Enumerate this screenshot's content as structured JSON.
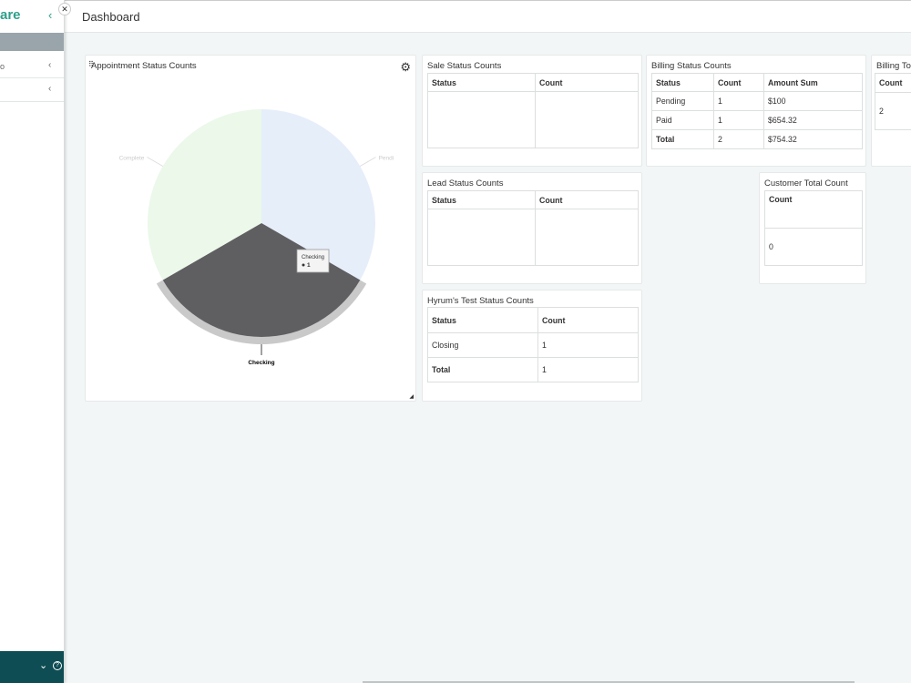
{
  "sidebar": {
    "brand": "are",
    "collapse_icon": "‹",
    "items": [
      {
        "dot": "o",
        "chevron": "‹"
      },
      {
        "dot": "",
        "chevron": "‹"
      }
    ],
    "close_icon": "✕",
    "footer": {
      "chevron": "⌄",
      "help": "?"
    }
  },
  "header": {
    "title": "Dashboard"
  },
  "appointment": {
    "title": "Appointment Status Counts",
    "drag_icon": "⠿",
    "gear_icon": "⚙",
    "resize_icon": "◢",
    "tooltip_label": "Checking",
    "tooltip_value": "1",
    "chart_data": {
      "type": "pie",
      "categories": [
        "Pending",
        "Checking",
        "Complete"
      ],
      "values": [
        1,
        1,
        1
      ],
      "colors": [
        "#e6eefa",
        "#5f5e61",
        "#ebf8ea"
      ],
      "labels_shown": [
        "Pendi",
        "Checking",
        "Complete"
      ],
      "highlighted": "Checking"
    }
  },
  "sale": {
    "title": "Sale Status Counts",
    "headers": [
      "Status",
      "Count"
    ]
  },
  "lead": {
    "title": "Lead Status Counts",
    "headers": [
      "Status",
      "Count"
    ]
  },
  "hyrum": {
    "title": "Hyrum's Test Status Counts",
    "headers": [
      "Status",
      "Count"
    ],
    "rows": [
      [
        "Closing",
        "1"
      ]
    ],
    "total": [
      "Total",
      "1"
    ]
  },
  "billing": {
    "title": "Billing Status Counts",
    "headers": [
      "Status",
      "Count",
      "Amount Sum"
    ],
    "rows": [
      [
        "Pending",
        "1",
        "$100"
      ],
      [
        "Paid",
        "1",
        "$654.32"
      ]
    ],
    "total": [
      "Total",
      "2",
      "$754.32"
    ]
  },
  "billing_total": {
    "title": "Billing To",
    "header": "Count",
    "value": "2"
  },
  "customer": {
    "title": "Customer Total Count",
    "header": "Count",
    "value": "0"
  }
}
